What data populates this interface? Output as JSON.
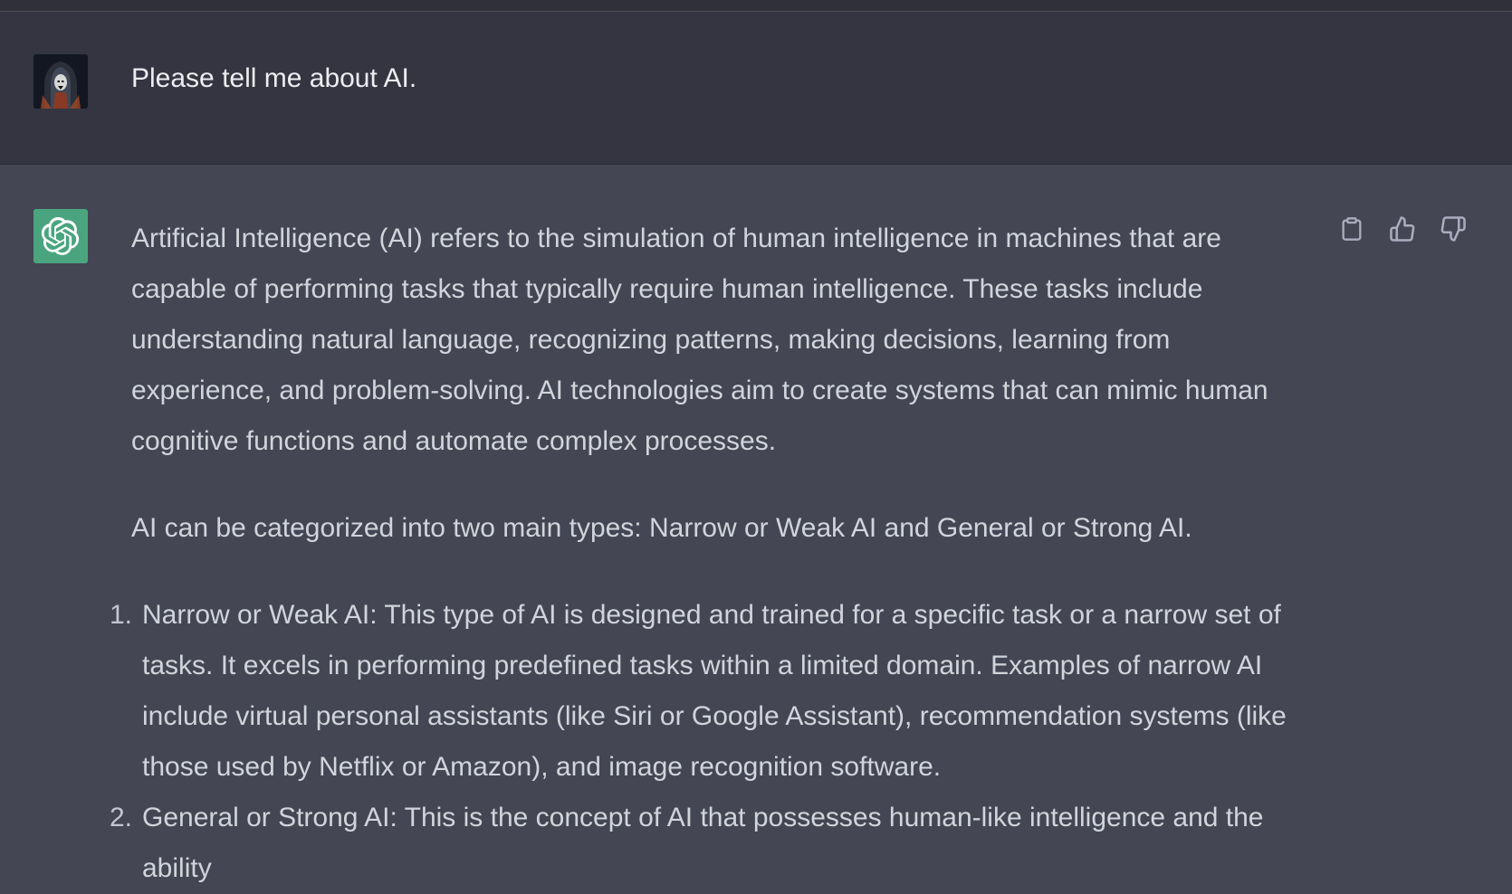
{
  "user_message": {
    "text": "Please tell me about AI.",
    "avatar_icon": "user-avatar-icon"
  },
  "assistant_message": {
    "avatar_icon": "openai-logo-icon",
    "paragraphs": [
      "Artificial Intelligence (AI) refers to the simulation of human intelligence in machines that are capable of performing tasks that typically require human intelligence. These tasks include understanding natural language, recognizing patterns, making decisions, learning from experience, and problem-solving. AI technologies aim to create systems that can mimic human cognitive functions and automate complex processes.",
      "AI can be categorized into two main types: Narrow or Weak AI and General or Strong AI."
    ],
    "list": [
      {
        "number": "1.",
        "text": "Narrow or Weak AI: This type of AI is designed and trained for a specific task or a narrow set of tasks. It excels in performing predefined tasks within a limited domain. Examples of narrow AI include virtual personal assistants (like Siri or Google Assistant), recommendation systems (like those used by Netflix or Amazon), and image recognition software."
      },
      {
        "number": "2.",
        "text": "General or Strong AI: This is the concept of AI that possesses human-like intelligence and the ability"
      }
    ]
  },
  "actions": {
    "icons": [
      "clipboard-icon",
      "thumbs-up-icon",
      "thumbs-down-icon"
    ]
  },
  "colors": {
    "user_bg": "#343541",
    "assistant_bg": "#444654",
    "bot_avatar": "#4aa57f",
    "text": "#d1d5db"
  }
}
